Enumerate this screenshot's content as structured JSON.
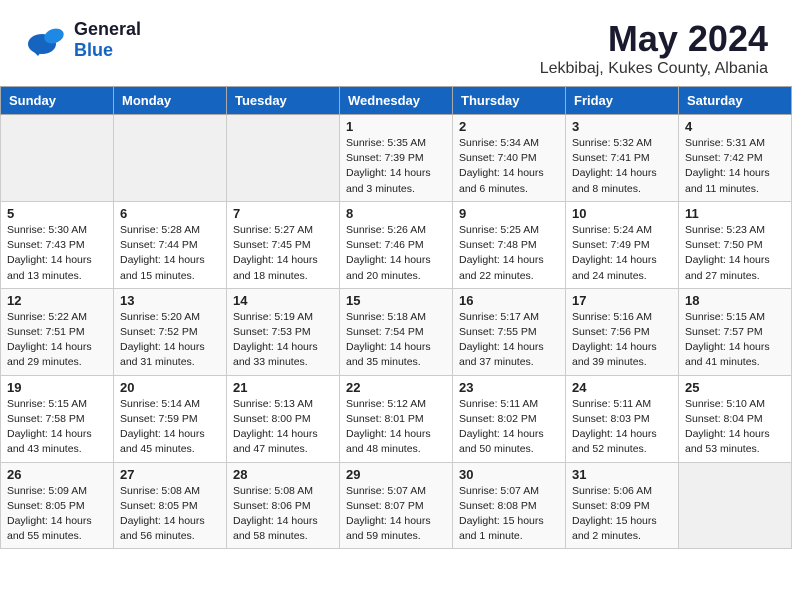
{
  "logo": {
    "general": "General",
    "blue": "Blue"
  },
  "title": "May 2024",
  "subtitle": "Lekbibaj, Kukes County, Albania",
  "weekdays": [
    "Sunday",
    "Monday",
    "Tuesday",
    "Wednesday",
    "Thursday",
    "Friday",
    "Saturday"
  ],
  "weeks": [
    [
      {
        "num": "",
        "info": ""
      },
      {
        "num": "",
        "info": ""
      },
      {
        "num": "",
        "info": ""
      },
      {
        "num": "1",
        "info": "Sunrise: 5:35 AM\nSunset: 7:39 PM\nDaylight: 14 hours\nand 3 minutes."
      },
      {
        "num": "2",
        "info": "Sunrise: 5:34 AM\nSunset: 7:40 PM\nDaylight: 14 hours\nand 6 minutes."
      },
      {
        "num": "3",
        "info": "Sunrise: 5:32 AM\nSunset: 7:41 PM\nDaylight: 14 hours\nand 8 minutes."
      },
      {
        "num": "4",
        "info": "Sunrise: 5:31 AM\nSunset: 7:42 PM\nDaylight: 14 hours\nand 11 minutes."
      }
    ],
    [
      {
        "num": "5",
        "info": "Sunrise: 5:30 AM\nSunset: 7:43 PM\nDaylight: 14 hours\nand 13 minutes."
      },
      {
        "num": "6",
        "info": "Sunrise: 5:28 AM\nSunset: 7:44 PM\nDaylight: 14 hours\nand 15 minutes."
      },
      {
        "num": "7",
        "info": "Sunrise: 5:27 AM\nSunset: 7:45 PM\nDaylight: 14 hours\nand 18 minutes."
      },
      {
        "num": "8",
        "info": "Sunrise: 5:26 AM\nSunset: 7:46 PM\nDaylight: 14 hours\nand 20 minutes."
      },
      {
        "num": "9",
        "info": "Sunrise: 5:25 AM\nSunset: 7:48 PM\nDaylight: 14 hours\nand 22 minutes."
      },
      {
        "num": "10",
        "info": "Sunrise: 5:24 AM\nSunset: 7:49 PM\nDaylight: 14 hours\nand 24 minutes."
      },
      {
        "num": "11",
        "info": "Sunrise: 5:23 AM\nSunset: 7:50 PM\nDaylight: 14 hours\nand 27 minutes."
      }
    ],
    [
      {
        "num": "12",
        "info": "Sunrise: 5:22 AM\nSunset: 7:51 PM\nDaylight: 14 hours\nand 29 minutes."
      },
      {
        "num": "13",
        "info": "Sunrise: 5:20 AM\nSunset: 7:52 PM\nDaylight: 14 hours\nand 31 minutes."
      },
      {
        "num": "14",
        "info": "Sunrise: 5:19 AM\nSunset: 7:53 PM\nDaylight: 14 hours\nand 33 minutes."
      },
      {
        "num": "15",
        "info": "Sunrise: 5:18 AM\nSunset: 7:54 PM\nDaylight: 14 hours\nand 35 minutes."
      },
      {
        "num": "16",
        "info": "Sunrise: 5:17 AM\nSunset: 7:55 PM\nDaylight: 14 hours\nand 37 minutes."
      },
      {
        "num": "17",
        "info": "Sunrise: 5:16 AM\nSunset: 7:56 PM\nDaylight: 14 hours\nand 39 minutes."
      },
      {
        "num": "18",
        "info": "Sunrise: 5:15 AM\nSunset: 7:57 PM\nDaylight: 14 hours\nand 41 minutes."
      }
    ],
    [
      {
        "num": "19",
        "info": "Sunrise: 5:15 AM\nSunset: 7:58 PM\nDaylight: 14 hours\nand 43 minutes."
      },
      {
        "num": "20",
        "info": "Sunrise: 5:14 AM\nSunset: 7:59 PM\nDaylight: 14 hours\nand 45 minutes."
      },
      {
        "num": "21",
        "info": "Sunrise: 5:13 AM\nSunset: 8:00 PM\nDaylight: 14 hours\nand 47 minutes."
      },
      {
        "num": "22",
        "info": "Sunrise: 5:12 AM\nSunset: 8:01 PM\nDaylight: 14 hours\nand 48 minutes."
      },
      {
        "num": "23",
        "info": "Sunrise: 5:11 AM\nSunset: 8:02 PM\nDaylight: 14 hours\nand 50 minutes."
      },
      {
        "num": "24",
        "info": "Sunrise: 5:11 AM\nSunset: 8:03 PM\nDaylight: 14 hours\nand 52 minutes."
      },
      {
        "num": "25",
        "info": "Sunrise: 5:10 AM\nSunset: 8:04 PM\nDaylight: 14 hours\nand 53 minutes."
      }
    ],
    [
      {
        "num": "26",
        "info": "Sunrise: 5:09 AM\nSunset: 8:05 PM\nDaylight: 14 hours\nand 55 minutes."
      },
      {
        "num": "27",
        "info": "Sunrise: 5:08 AM\nSunset: 8:05 PM\nDaylight: 14 hours\nand 56 minutes."
      },
      {
        "num": "28",
        "info": "Sunrise: 5:08 AM\nSunset: 8:06 PM\nDaylight: 14 hours\nand 58 minutes."
      },
      {
        "num": "29",
        "info": "Sunrise: 5:07 AM\nSunset: 8:07 PM\nDaylight: 14 hours\nand 59 minutes."
      },
      {
        "num": "30",
        "info": "Sunrise: 5:07 AM\nSunset: 8:08 PM\nDaylight: 15 hours\nand 1 minute."
      },
      {
        "num": "31",
        "info": "Sunrise: 5:06 AM\nSunset: 8:09 PM\nDaylight: 15 hours\nand 2 minutes."
      },
      {
        "num": "",
        "info": ""
      }
    ]
  ]
}
